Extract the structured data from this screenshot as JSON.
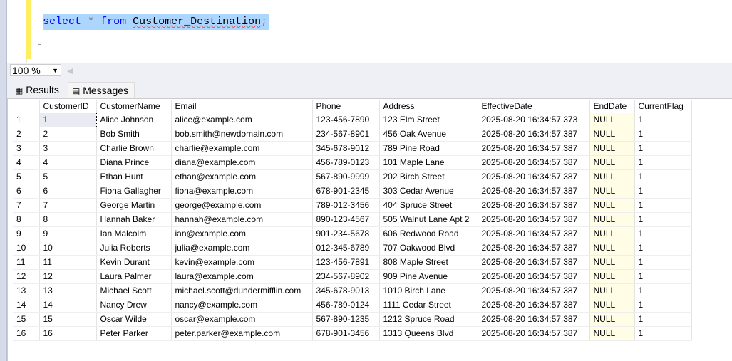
{
  "editor": {
    "kw_select": "select",
    "op_star": "*",
    "kw_from": "from",
    "table": "Customer_Destination",
    "semi": ";"
  },
  "zoom": {
    "value": "100 %"
  },
  "tabs": {
    "results": "Results",
    "messages": "Messages"
  },
  "columns": [
    "CustomerID",
    "CustomerName",
    "Email",
    "Phone",
    "Address",
    "EffectiveDate",
    "EndDate",
    "CurrentFlag"
  ],
  "rows": [
    [
      "1",
      "1",
      "Alice Johnson",
      "alice@example.com",
      "123-456-7890",
      "123 Elm Street",
      "2025-08-20 16:34:57.373",
      "NULL",
      "1"
    ],
    [
      "2",
      "2",
      "Bob Smith",
      "bob.smith@newdomain.com",
      "234-567-8901",
      "456 Oak Avenue",
      "2025-08-20 16:34:57.387",
      "NULL",
      "1"
    ],
    [
      "3",
      "3",
      "Charlie Brown",
      "charlie@example.com",
      "345-678-9012",
      "789 Pine Road",
      "2025-08-20 16:34:57.387",
      "NULL",
      "1"
    ],
    [
      "4",
      "4",
      "Diana Prince",
      "diana@example.com",
      "456-789-0123",
      "101 Maple Lane",
      "2025-08-20 16:34:57.387",
      "NULL",
      "1"
    ],
    [
      "5",
      "5",
      "Ethan Hunt",
      "ethan@example.com",
      "567-890-9999",
      "202 Birch Street",
      "2025-08-20 16:34:57.387",
      "NULL",
      "1"
    ],
    [
      "6",
      "6",
      "Fiona Gallagher",
      "fiona@example.com",
      "678-901-2345",
      "303 Cedar Avenue",
      "2025-08-20 16:34:57.387",
      "NULL",
      "1"
    ],
    [
      "7",
      "7",
      "George Martin",
      "george@example.com",
      "789-012-3456",
      "404 Spruce Street",
      "2025-08-20 16:34:57.387",
      "NULL",
      "1"
    ],
    [
      "8",
      "8",
      "Hannah Baker",
      "hannah@example.com",
      "890-123-4567",
      "505 Walnut Lane Apt 2",
      "2025-08-20 16:34:57.387",
      "NULL",
      "1"
    ],
    [
      "9",
      "9",
      "Ian Malcolm",
      "ian@example.com",
      "901-234-5678",
      "606 Redwood Road",
      "2025-08-20 16:34:57.387",
      "NULL",
      "1"
    ],
    [
      "10",
      "10",
      "Julia Roberts",
      "julia@example.com",
      "012-345-6789",
      "707 Oakwood Blvd",
      "2025-08-20 16:34:57.387",
      "NULL",
      "1"
    ],
    [
      "11",
      "11",
      "Kevin Durant",
      "kevin@example.com",
      "123-456-7891",
      "808 Maple Street",
      "2025-08-20 16:34:57.387",
      "NULL",
      "1"
    ],
    [
      "12",
      "12",
      "Laura Palmer",
      "laura@example.com",
      "234-567-8902",
      "909 Pine Avenue",
      "2025-08-20 16:34:57.387",
      "NULL",
      "1"
    ],
    [
      "13",
      "13",
      "Michael Scott",
      "michael.scott@dundermifflin.com",
      "345-678-9013",
      "1010 Birch Lane",
      "2025-08-20 16:34:57.387",
      "NULL",
      "1"
    ],
    [
      "14",
      "14",
      "Nancy Drew",
      "nancy@example.com",
      "456-789-0124",
      "1111 Cedar Street",
      "2025-08-20 16:34:57.387",
      "NULL",
      "1"
    ],
    [
      "15",
      "15",
      "Oscar Wilde",
      "oscar@example.com",
      "567-890-1235",
      "1212 Spruce Road",
      "2025-08-20 16:34:57.387",
      "NULL",
      "1"
    ],
    [
      "16",
      "16",
      "Peter Parker",
      "peter.parker@example.com",
      "678-901-3456",
      "1313 Queens Blvd",
      "2025-08-20 16:34:57.387",
      "NULL",
      "1"
    ]
  ]
}
